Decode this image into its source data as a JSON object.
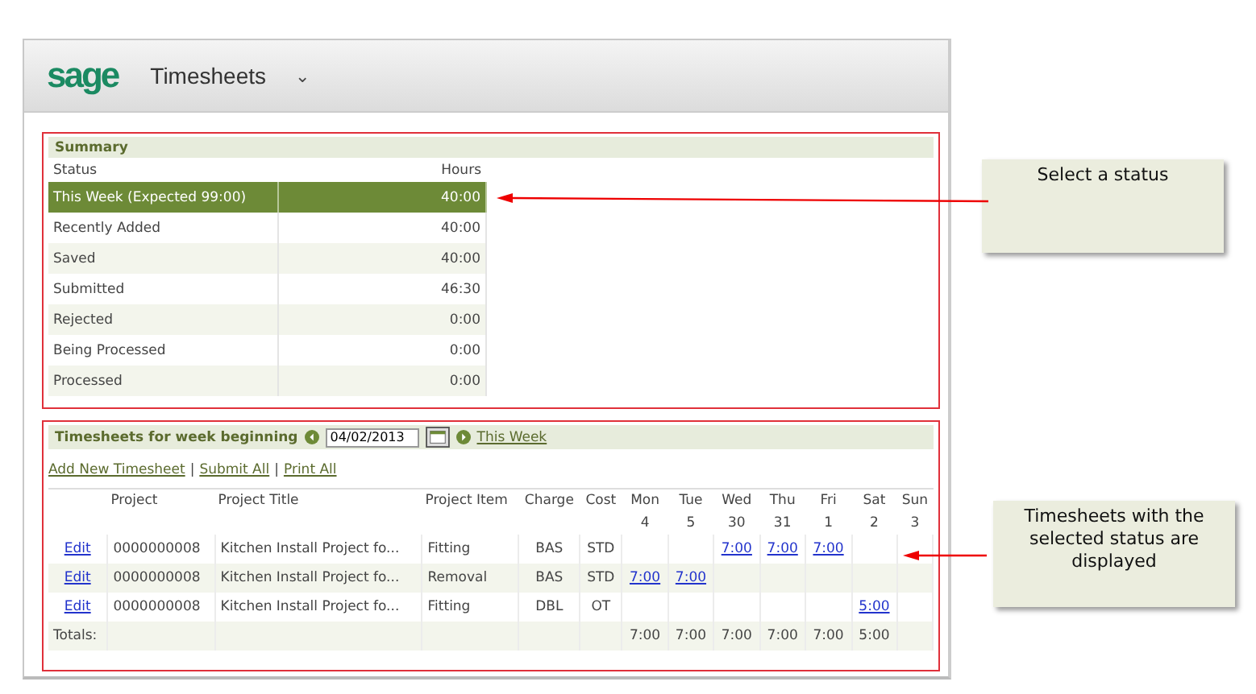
{
  "header": {
    "logo": "sage",
    "title": "Timesheets",
    "menu_caret": "⌄"
  },
  "summary": {
    "title": "Summary",
    "columns": [
      "Status",
      "Hours"
    ],
    "rows": [
      {
        "status": "This Week (Expected 99:00)",
        "hours": "40:00",
        "selected": true
      },
      {
        "status": "Recently Added",
        "hours": "40:00",
        "selected": false
      },
      {
        "status": "Saved",
        "hours": "40:00",
        "selected": false
      },
      {
        "status": "Submitted",
        "hours": "46:30",
        "selected": false
      },
      {
        "status": "Rejected",
        "hours": "0:00",
        "selected": false
      },
      {
        "status": "Being Processed",
        "hours": "0:00",
        "selected": false
      },
      {
        "status": "Processed",
        "hours": "0:00",
        "selected": false
      }
    ]
  },
  "timesheets": {
    "title": "Timesheets for week beginning",
    "date": "04/02/2013",
    "this_week_link": "This Week",
    "actions": [
      "Add New Timesheet",
      "Submit All",
      "Print All"
    ],
    "action_separator": "|",
    "columns": [
      "Project",
      "Project Title",
      "Project Item",
      "Charge",
      "Cost"
    ],
    "days": [
      {
        "day": "Mon",
        "date": "4"
      },
      {
        "day": "Tue",
        "date": "5"
      },
      {
        "day": "Wed",
        "date": "30"
      },
      {
        "day": "Thu",
        "date": "31"
      },
      {
        "day": "Fri",
        "date": "1"
      },
      {
        "day": "Sat",
        "date": "2"
      },
      {
        "day": "Sun",
        "date": "3"
      }
    ],
    "rows": [
      {
        "edit": "Edit",
        "project": "0000000008",
        "title": "Kitchen Install Project fo...",
        "item": "Fitting",
        "charge": "BAS",
        "cost": "STD",
        "hours": {
          "wed": "7:00",
          "thu": "7:00",
          "fri": "7:00"
        }
      },
      {
        "edit": "Edit",
        "project": "0000000008",
        "title": "Kitchen Install Project fo...",
        "item": "Removal",
        "charge": "BAS",
        "cost": "STD",
        "hours": {
          "mon": "7:00",
          "tue": "7:00"
        }
      },
      {
        "edit": "Edit",
        "project": "0000000008",
        "title": "Kitchen Install Project fo...",
        "item": "Fitting",
        "charge": "DBL",
        "cost": "OT",
        "hours": {
          "sat": "5:00"
        }
      }
    ],
    "totals_label": "Totals:",
    "totals": {
      "mon": "7:00",
      "tue": "7:00",
      "wed": "7:00",
      "thu": "7:00",
      "fri": "7:00",
      "sat": "5:00"
    }
  },
  "callouts": [
    "Select a status",
    "Timesheets with the selected status are displayed"
  ]
}
